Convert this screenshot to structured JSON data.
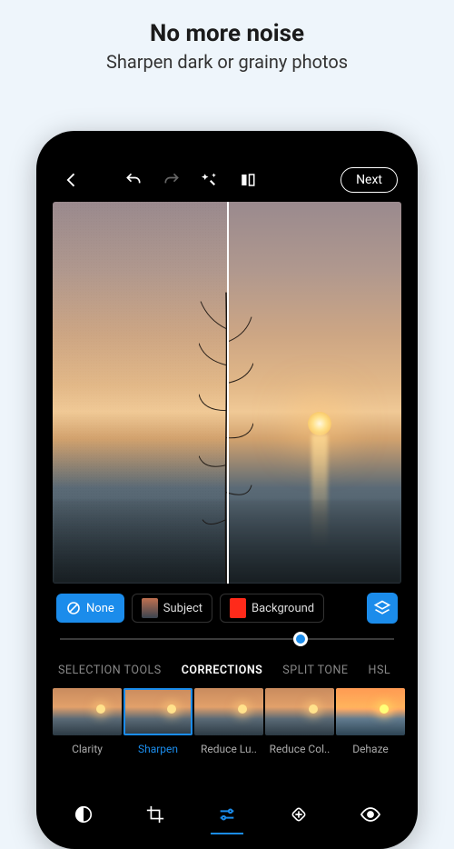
{
  "promo": {
    "title": "No more noise",
    "subtitle": "Sharpen dark or grainy photos"
  },
  "toolbar": {
    "next_label": "Next"
  },
  "masks": {
    "none": "None",
    "subject": "Subject",
    "background": "Background"
  },
  "slider": {
    "value": 72
  },
  "categories": {
    "selection_tools": "SELECTION TOOLS",
    "corrections": "CORRECTIONS",
    "split_tone": "SPLIT TONE",
    "hsl": "HSL"
  },
  "corrections": {
    "clarity": "Clarity",
    "sharpen": "Sharpen",
    "reduce_lum": "Reduce Lu..",
    "reduce_col": "Reduce Col..",
    "dehaze": "Dehaze"
  }
}
